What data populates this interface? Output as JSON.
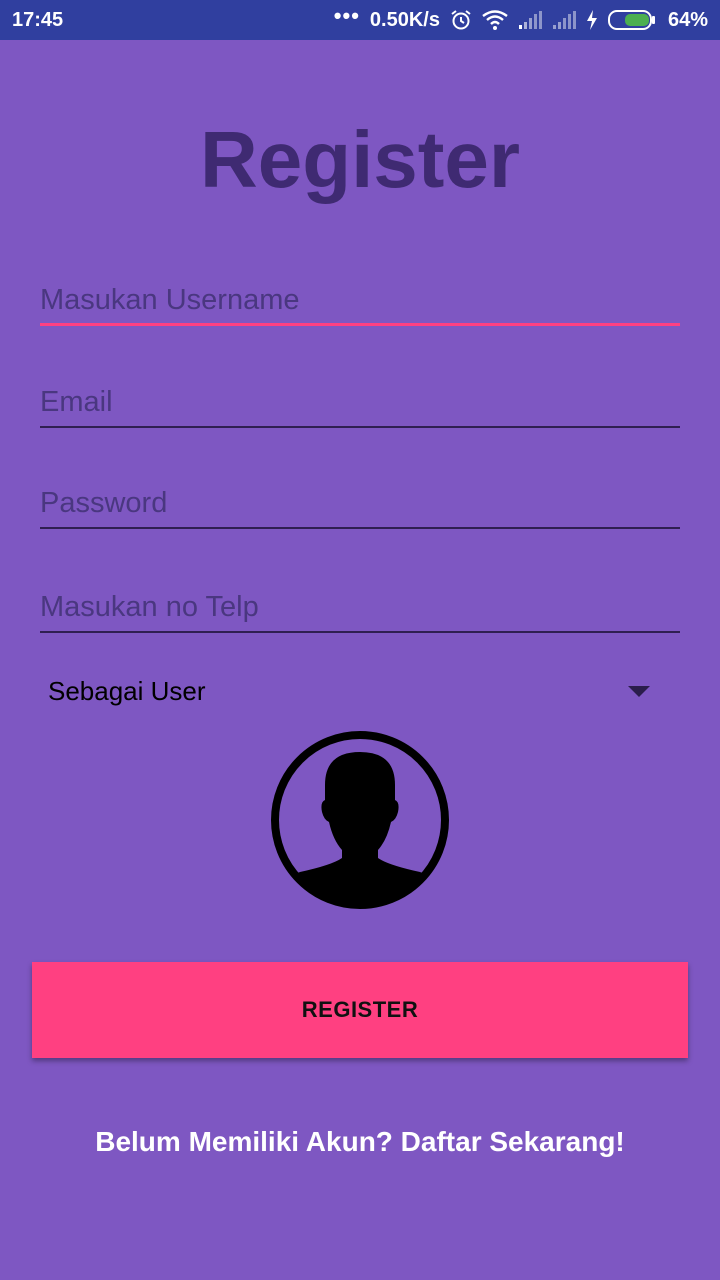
{
  "status_bar": {
    "time": "17:45",
    "dots": "•••",
    "net_speed": "0.50K/s",
    "battery_percent": "64%",
    "battery_color": "#4caf50",
    "icons": [
      "alarm-icon",
      "wifi-icon",
      "signal-icon",
      "signal-icon",
      "charging-icon",
      "battery-icon"
    ]
  },
  "page": {
    "title": "Register",
    "background": "#7e57c2",
    "accent": "#ff4081"
  },
  "form": {
    "username": {
      "placeholder": "Masukan Username",
      "value": ""
    },
    "email": {
      "placeholder": "Email",
      "value": ""
    },
    "password": {
      "placeholder": "Password",
      "value": ""
    },
    "phone": {
      "placeholder": "Masukan no Telp",
      "value": ""
    },
    "role": {
      "selected": "Sebagai User"
    },
    "avatar_icon": "user-silhouette-icon"
  },
  "actions": {
    "register_label": "REGISTER",
    "signup_link": "Belum Memiliki Akun? Daftar Sekarang!"
  }
}
